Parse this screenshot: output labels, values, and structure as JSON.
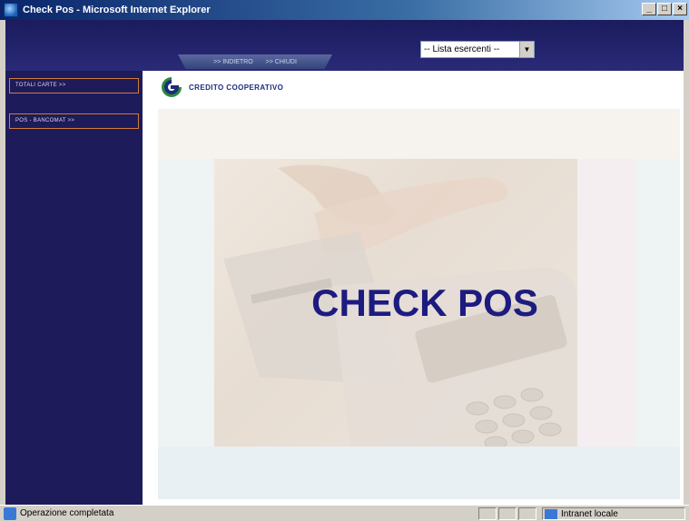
{
  "window": {
    "title": "Check Pos - Microsoft Internet Explorer",
    "controls": {
      "minimize": "_",
      "maximize": "□",
      "close": "×"
    }
  },
  "header": {
    "tabs": [
      {
        "label": ">> INDIETRO"
      },
      {
        "label": ">> CHIUDI"
      }
    ],
    "merchant_select": {
      "value": "-- Lista esercenti --"
    }
  },
  "sidebar": {
    "items": [
      {
        "label": "TOTALI CARTE >>"
      },
      {
        "label": "POS - BANCOMAT >>"
      }
    ]
  },
  "logo": {
    "text": "CREDITO COOPERATIVO",
    "icon": "credito-cooperativo-logo"
  },
  "main": {
    "headline": "CHECK POS"
  },
  "statusbar": {
    "text": "Operazione completata",
    "zone": "Intranet locale"
  },
  "colors": {
    "sidebar_bg": "#1e1b5a",
    "headline": "#1d1b80",
    "sidebar_border": "#d07a3c"
  }
}
